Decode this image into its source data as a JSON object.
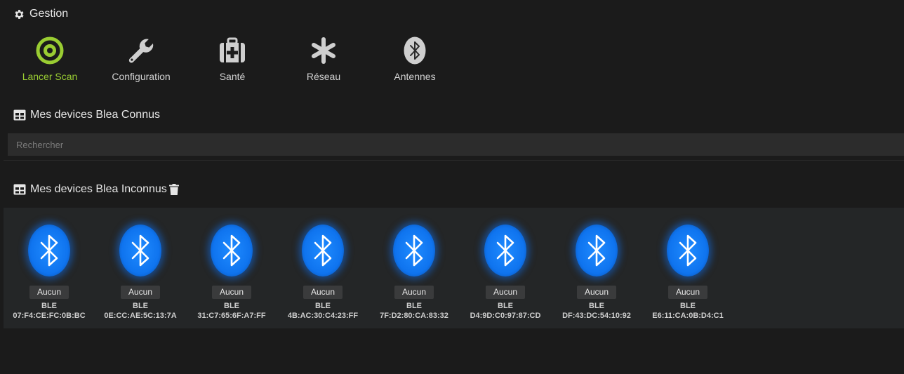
{
  "gestion": {
    "title": "Gestion",
    "actions": [
      {
        "label": "Lancer Scan",
        "icon": "target-icon"
      },
      {
        "label": "Configuration",
        "icon": "wrench-icon"
      },
      {
        "label": "Santé",
        "icon": "medkit-icon"
      },
      {
        "label": "Réseau",
        "icon": "asterisk-icon"
      },
      {
        "label": "Antennes",
        "icon": "bluetooth-badge-icon"
      }
    ]
  },
  "known": {
    "title": "Mes devices Blea Connus",
    "search_placeholder": "Rechercher"
  },
  "unknown": {
    "title": "Mes devices Blea Inconnus",
    "devices": [
      {
        "badge": "Aucun",
        "type": "BLE",
        "mac": "07:F4:CE:FC:0B:BC"
      },
      {
        "badge": "Aucun",
        "type": "BLE",
        "mac": "0E:CC:AE:5C:13:7A"
      },
      {
        "badge": "Aucun",
        "type": "BLE",
        "mac": "31:C7:65:6F:A7:FF"
      },
      {
        "badge": "Aucun",
        "type": "BLE",
        "mac": "4B:AC:30:C4:23:FF"
      },
      {
        "badge": "Aucun",
        "type": "BLE",
        "mac": "7F:D2:80:CA:83:32"
      },
      {
        "badge": "Aucun",
        "type": "BLE",
        "mac": "D4:9D:C0:97:87:CD"
      },
      {
        "badge": "Aucun",
        "type": "BLE",
        "mac": "DF:43:DC:54:10:92"
      },
      {
        "badge": "Aucun",
        "type": "BLE",
        "mac": "E6:11:CA:0B:D4:C1"
      }
    ]
  },
  "colors": {
    "accent": "#9acd32",
    "bluetooth": "#0f74ef",
    "background": "#1b1b1b"
  }
}
